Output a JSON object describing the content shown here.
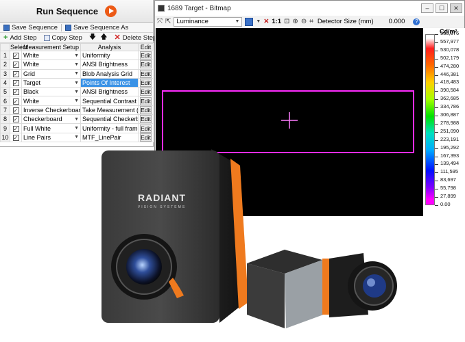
{
  "sequence": {
    "run_label": "Run Sequence",
    "toolbar1": {
      "save": "Save Sequence",
      "save_as": "Save Sequence As"
    },
    "toolbar2": {
      "add": "Add Step",
      "copy": "Copy Step",
      "delete": "Delete Step"
    },
    "headers": {
      "select": "Select",
      "setup": "Measurement Setup",
      "analysis": "Analysis",
      "edit": "Edit"
    },
    "edit_label": "Edit",
    "rows": [
      {
        "num": "1",
        "setup": "White",
        "analysis": "Uniformity"
      },
      {
        "num": "2",
        "setup": "White",
        "analysis": "ANSI Brightness"
      },
      {
        "num": "3",
        "setup": "Grid",
        "analysis": "Blob Analysis Grid"
      },
      {
        "num": "4",
        "setup": "Target",
        "analysis": "Points Of Interest"
      },
      {
        "num": "5",
        "setup": "Black",
        "analysis": "ANSI Brightness"
      },
      {
        "num": "6",
        "setup": "White",
        "analysis": "Sequential Contrast"
      },
      {
        "num": "7",
        "setup": "Inverse Checkerboard",
        "analysis": "Take Measurement (no A..."
      },
      {
        "num": "8",
        "setup": "Checkerboard",
        "analysis": "Sequential Checkerboard ..."
      },
      {
        "num": "9",
        "setup": "Full White",
        "analysis": "Uniformity - full frame"
      },
      {
        "num": "10",
        "setup": "Line Pairs",
        "analysis": "MTF_LinePair"
      }
    ]
  },
  "bitmap": {
    "title": "1689 Target - Bitmap",
    "mode": "Luminance",
    "zoom_label": "1:1",
    "detector_label": "Detector Size (mm)",
    "detector_value": "0.000",
    "unit": "Cd/m²",
    "scale_ticks": [
      "585,876",
      "557,977",
      "530,078",
      "502,179",
      "474,280",
      "446,381",
      "418,483",
      "390,584",
      "362,685",
      "334,786",
      "306,887",
      "278,988",
      "251,090",
      "223,191",
      "195,292",
      "167,393",
      "139,494",
      "111,595",
      "83,697",
      "55,798",
      "27,899",
      "0.00"
    ]
  },
  "brand": {
    "name": "RADIANT",
    "sub": "VISION SYSTEMS"
  },
  "colors": {
    "accent": "#ec5a16",
    "selection": "#3a92e6",
    "target": "#ff2cff",
    "camera_orange": "#ef7a1e"
  }
}
